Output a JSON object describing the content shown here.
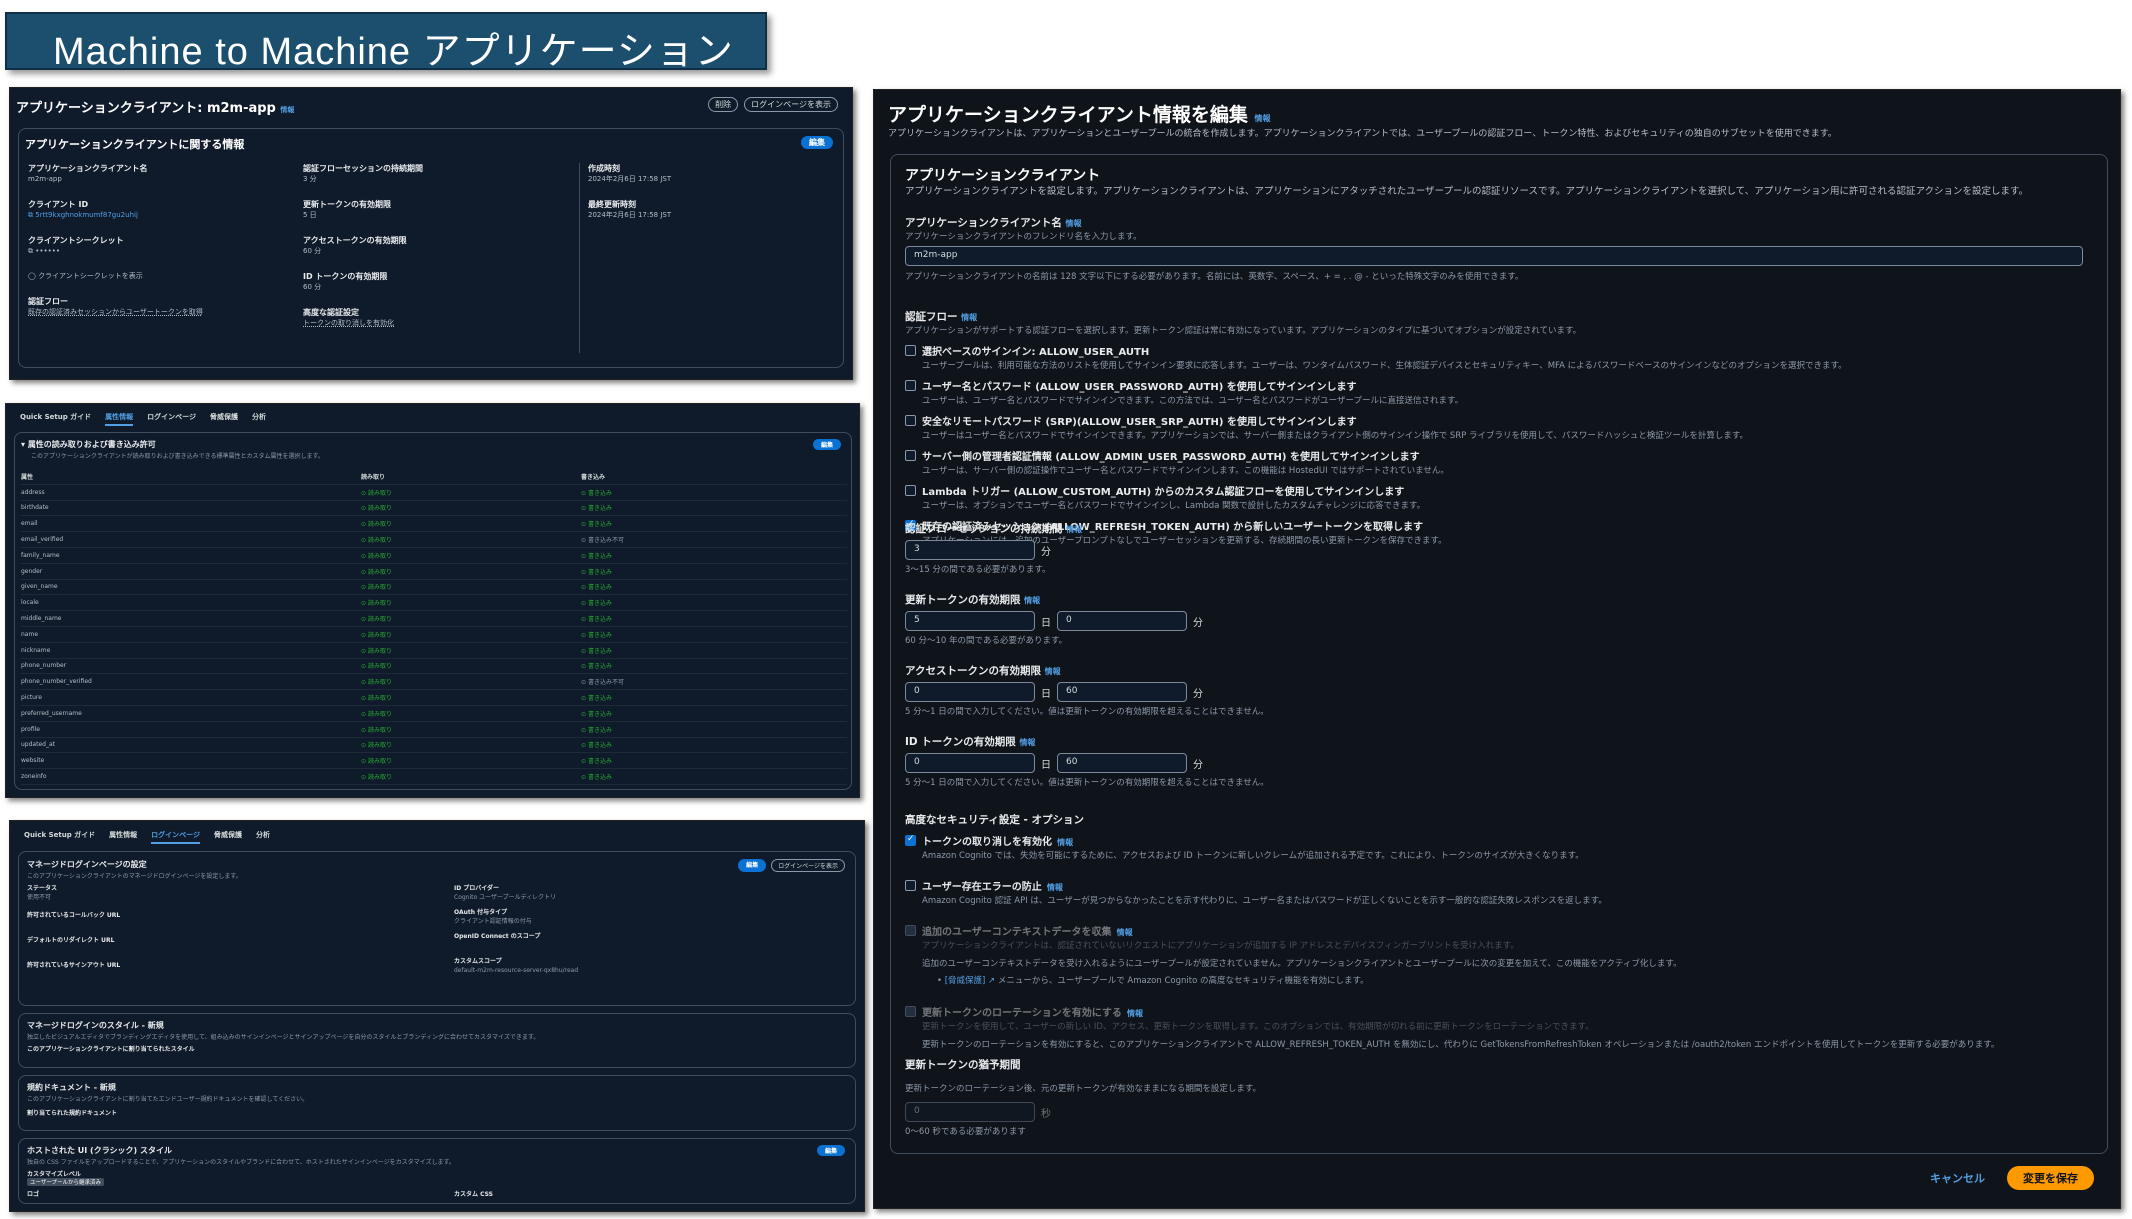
{
  "banner": {
    "title": "Machine to Machine アプリケーション"
  },
  "p1": {
    "page_title": "アプリケーションクライアント: m2m-app",
    "info": "情報",
    "btn_delete": "削除",
    "btn_view_login": "ログインページを表示",
    "section_title": "アプリケーションクライアントに関する情報",
    "btn_edit": "編集",
    "fields": {
      "app_client_name_label": "アプリケーションクライアント名",
      "app_client_name_value": "m2m-app",
      "client_id_label": "クライアント ID",
      "client_id_value": "5rtt9kxghnokmumf87gu2uhij",
      "client_secret_label": "クライアントシークレット",
      "client_secret_value": "••••••",
      "show_secret": "クライアントシークレットを表示",
      "auth_flow_label": "認証フロー",
      "auth_flow_value": "既存の認証済みセッションからユーザートークンを取得",
      "session_label": "認証フローセッションの持続期間",
      "session_value": "3 分",
      "refresh_label": "更新トークンの有効期限",
      "refresh_value": "5 日",
      "access_label": "アクセストークンの有効期限",
      "access_value": "60 分",
      "id_label": "ID トークンの有効期限",
      "id_value": "60 分",
      "advanced_label": "高度な認証設定",
      "advanced_value": "トークンの取り消しを有効化",
      "created_label": "作成時刻",
      "created_value": "2024年2月6日 17:58 JST",
      "updated_label": "最終更新時刻",
      "updated_value": "2024年2月6日 17:58 JST"
    }
  },
  "p2": {
    "tabs": [
      "Quick Setup ガイド",
      "属性情報",
      "ログインページ",
      "脅威保護",
      "分析"
    ],
    "section_title": "属性の読み取りおよび書き込み許可",
    "section_desc": "このアプリケーションクライアントが読み取りおよび書き込みできる標準属性とカスタム属性を選択します。",
    "btn_edit": "編集",
    "headers": [
      "属性",
      "読み取り",
      "書き込み"
    ],
    "read_label": "読み取り",
    "write_label": "書き込み",
    "write_no_label": "書き込み不可",
    "rows": [
      {
        "name": "address",
        "write": true
      },
      {
        "name": "birthdate",
        "write": true
      },
      {
        "name": "email",
        "write": true
      },
      {
        "name": "email_verified",
        "write": false
      },
      {
        "name": "family_name",
        "write": true
      },
      {
        "name": "gender",
        "write": true
      },
      {
        "name": "given_name",
        "write": true
      },
      {
        "name": "locale",
        "write": true
      },
      {
        "name": "middle_name",
        "write": true
      },
      {
        "name": "name",
        "write": true
      },
      {
        "name": "nickname",
        "write": true
      },
      {
        "name": "phone_number",
        "write": true
      },
      {
        "name": "phone_number_verified",
        "write": false
      },
      {
        "name": "picture",
        "write": true
      },
      {
        "name": "preferred_username",
        "write": true
      },
      {
        "name": "profile",
        "write": true
      },
      {
        "name": "updated_at",
        "write": true
      },
      {
        "name": "website",
        "write": true
      },
      {
        "name": "zoneinfo",
        "write": true
      }
    ]
  },
  "p3": {
    "tabs": [
      "Quick Setup ガイド",
      "属性情報",
      "ログインページ",
      "脅威保護",
      "分析"
    ],
    "managed_title": "マネージドログインページの設定",
    "managed_desc": "このアプリケーションクライアントのマネージドログインページを設定します。",
    "btn_edit": "編集",
    "btn_view_login": "ログインページを表示",
    "status_label": "ステータス",
    "status_value": "使用不可",
    "callback_label": "許可されているコールバック URL",
    "redirect_label": "デフォルトのリダイレクト URL",
    "signout_label": "許可されているサインアウト URL",
    "idp_label": "ID プロバイダー",
    "idp_value": "Cognito ユーザープールディレクトリ",
    "oauth_label": "OAuth 付与タイプ",
    "oauth_value": "クライアント認証情報の付与",
    "oidc_label": "OpenID Connect のスコープ",
    "scope_label": "カスタムスコープ",
    "scope_value": "default-m2m-resource-server-qx8hu/read",
    "style_title": "マネージドログインのスタイル - 新規",
    "style_desc": "独立したビジュアルエディタでブランディングエディタを使用して、組み込みのサインインページとサインアップページを自分のスタイルとブランディングに合わせてカスタマイズできます。",
    "style_assigned": "このアプリケーションクライアントに割り当てられたスタイル",
    "terms_title": "規約ドキュメント - 新規",
    "terms_desc": "このアプリケーションクライアントに割り当てたエンドユーザー規約ドキュメントを確認してください。",
    "terms_assigned": "割り当てられた規約ドキュメント",
    "classic_title": "ホストされた UI (クラシック) スタイル",
    "classic_desc": "独自の CSS ファイルをアップロードすることで、アプリケーションのスタイルやブランドに合わせて、ホストされたサインインページをカスタマイズします。",
    "custom_level": "カスタマイズレベル",
    "custom_level_value": "ユーザープールから継承済み",
    "logo_label": "ロゴ",
    "css_label": "カスタム CSS",
    "btn_edit2": "編集"
  },
  "editor": {
    "title": "アプリケーションクライアント情報を編集",
    "info": "情報",
    "desc": "アプリケーションクライアントは、アプリケーションとユーザープールの統合を作成します。アプリケーションクライアントでは、ユーザープールの認証フロー、トークン特性、およびセキュリティの独自のサブセットを使用できます。",
    "section_title": "アプリケーションクライアント",
    "section_desc": "アプリケーションクライアントを設定します。アプリケーションクライアントは、アプリケーションにアタッチされたユーザープールの認証リソースです。アプリケーションクライアントを選択して、アプリケーション用に許可される認証アクションを設定します。",
    "name_label": "アプリケーションクライアント名",
    "name_sub": "アプリケーションクライアントのフレンドリ名を入力します。",
    "name_value": "m2m-app",
    "name_hint": "アプリケーションクライアントの名前は 128 文字以下にする必要があります。名前には、英数字、スペース、+ = , . @ - といった特殊文字のみを使用できます。",
    "flow_label": "認証フロー",
    "flow_sub": "アプリケーションがサポートする認証フローを選択します。更新トークン認証は常に有効になっています。アプリケーションのタイプに基づいてオプションが設定されています。",
    "flows": [
      {
        "label": "選択ベースのサインイン: ALLOW_USER_AUTH",
        "desc": "ユーザープールは、利用可能な方法のリストを使用してサインイン要求に応答します。ユーザーは、ワンタイムパスワード、生体認証デバイスとセキュリティキー、MFA によるパスワードベースのサインインなどのオプションを選択できます。",
        "on": false
      },
      {
        "label": "ユーザー名とパスワード (ALLOW_USER_PASSWORD_AUTH) を使用してサインインします",
        "desc": "ユーザーは、ユーザー名とパスワードでサインインできます。この方法では、ユーザー名とパスワードがユーザープールに直接送信されます。",
        "on": false
      },
      {
        "label": "安全なリモートパスワード (SRP)(ALLOW_USER_SRP_AUTH) を使用してサインインします",
        "desc": "ユーザーはユーザー名とパスワードでサインインできます。アプリケーションでは、サーバー側またはクライアント側のサインイン操作で SRP ライブラリを使用して、パスワードハッシュと検証ツールを計算します。",
        "on": false
      },
      {
        "label": "サーバー側の管理者認証情報 (ALLOW_ADMIN_USER_PASSWORD_AUTH) を使用してサインインします",
        "desc": "ユーザーは、サーバー側の認証操作でユーザー名とパスワードでサインインします。この機能は HostedUI ではサポートされていません。",
        "on": false
      },
      {
        "label": "Lambda トリガー (ALLOW_CUSTOM_AUTH) からのカスタム認証フローを使用してサインインします",
        "desc": "ユーザーは、オプションでユーザー名とパスワードでサインインし、Lambda 関数で設計したカスタムチャレンジに応答できます。",
        "on": false
      },
      {
        "label": "既存の認証済みセッション (ALLOW_REFRESH_TOKEN_AUTH) から新しいユーザートークンを取得します",
        "desc": "アプリケーションには、追加のユーザープロンプトなしでユーザーセッションを更新する、存続期間の長い更新トークンを保存できます。",
        "on": true
      }
    ],
    "session_label": "認証フローセッションの持続期間",
    "session_value": "3",
    "session_unit": "分",
    "session_hint": "3～15 分の間である必要があります。",
    "refresh_label": "更新トークンの有効期限",
    "refresh_days": "5",
    "refresh_mins": "0",
    "refresh_hint": "60 分～10 年の間である必要があります。",
    "access_label": "アクセストークンの有効期限",
    "access_days": "0",
    "access_mins": "60",
    "access_hint": "5 分～1 日の間で入力してください。値は更新トークンの有効期限を超えることはできません。",
    "idtok_label": "ID トークンの有効期限",
    "idtok_days": "0",
    "idtok_mins": "60",
    "idtok_hint": "5 分～1 日の間で入力してください。値は更新トークンの有効期限を超えることはできません。",
    "unit_day": "日",
    "unit_min": "分",
    "adv_label": "高度なセキュリティ設定 - オプション",
    "revoke_label": "トークンの取り消しを有効化",
    "revoke_desc": "Amazon Cognito では、失効を可能にするために、アクセスおよび ID トークンに新しいクレームが追加される予定です。これにより、トークンのサイズが大きくなります。",
    "ueep_label": "ユーザー存在エラーの防止",
    "ueep_desc": "Amazon Cognito 認証 API は、ユーザーが見つからなかったことを示す代わりに、ユーザー名またはパスワードが正しくないことを示す一般的な認証失敗レスポンスを返します。",
    "ctx_label": "追加のユーザーコンテキストデータを収集",
    "ctx_desc": "アプリケーションクライアントは、認証されていないリクエストにアプリケーションが追加する IP アドレスとデバイスフィンガープリントを受け入れます。",
    "ctx_desc2": "追加のユーザーコンテキストデータを受け入れるようにユーザープールが設定されていません。アプリケーションクライアントとユーザープールに次の変更を加えて、この機能をアクティブ化します。",
    "ctx_bullet_link": "[脅威保護]",
    "ctx_bullet": "メニューから、ユーザープールで Amazon Cognito の高度なセキュリティ機能を有効にします。",
    "rotate_label": "更新トークンのローテーションを有効にする",
    "rotate_desc": "更新トークンを使用して、ユーザーの新しい ID、アクセス、更新トークンを取得します。このオプションでは、有効期限が切れる前に更新トークンをローテーションできます。",
    "rotate_desc2": "更新トークンのローテーションを有効にすると、このアプリケーションクライアントで ALLOW_REFRESH_TOKEN_AUTH を無効にし、代わりに GetTokensFromRefreshToken オペレーションまたは /oauth2/token エンドポイントを使用してトークンを更新する必要があります。",
    "grace_label": "更新トークンの猶予期間",
    "grace_sub": "更新トークンのローテーション後、元の更新トークンが有効なままになる期間を設定します。",
    "grace_value": "0",
    "grace_unit": "秒",
    "grace_hint": "0～60 秒である必要があります",
    "cancel": "キャンセル",
    "save": "変更を保存"
  }
}
